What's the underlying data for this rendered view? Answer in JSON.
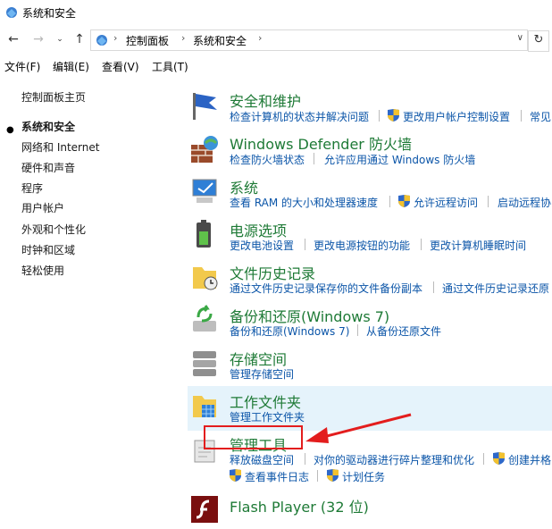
{
  "window": {
    "title": "系统和安全"
  },
  "address": {
    "crumbs": [
      "控制面板",
      "系统和安全"
    ]
  },
  "menu": [
    "文件(F)",
    "编辑(E)",
    "查看(V)",
    "工具(T)"
  ],
  "sidebar": {
    "items": [
      "控制面板主页",
      "系统和安全",
      "网络和 Internet",
      "硬件和声音",
      "程序",
      "用户帐户",
      "外观和个性化",
      "时钟和区域",
      "轻松使用"
    ]
  },
  "categories": [
    {
      "title": "安全和维护",
      "links": [
        "检查计算机的状态并解决问题",
        "更改用户帐户控制设置",
        "常见"
      ]
    },
    {
      "title": "Windows Defender 防火墙",
      "links": [
        "检查防火墙状态",
        "允许应用通过 Windows 防火墙"
      ]
    },
    {
      "title": "系统",
      "links": [
        "查看 RAM 的大小和处理器速度",
        "允许远程访问",
        "启动远程协"
      ]
    },
    {
      "title": "电源选项",
      "links": [
        "更改电池设置",
        "更改电源按钮的功能",
        "更改计算机睡眠时间"
      ]
    },
    {
      "title": "文件历史记录",
      "links": [
        "通过文件历史记录保存你的文件备份副本",
        "通过文件历史记录还原"
      ]
    },
    {
      "title": "备份和还原(Windows 7)",
      "links": [
        "备份和还原(Windows 7)",
        "从备份还原文件"
      ]
    },
    {
      "title": "存储空间",
      "links": [
        "管理存储空间"
      ]
    },
    {
      "title": "工作文件夹",
      "links": [
        "管理工作文件夹"
      ]
    },
    {
      "title": "管理工具",
      "links": [
        "释放磁盘空间",
        "对你的驱动器进行碎片整理和优化",
        "创建并格",
        "查看事件日志",
        "计划任务"
      ]
    },
    {
      "title": "Flash Player (32 位)",
      "links": []
    }
  ],
  "colors": {
    "title_green": "#1e7a36",
    "link_blue": "#0b55a8",
    "highlight": "#e5f3fb",
    "annotation_red": "#e31d1d"
  }
}
